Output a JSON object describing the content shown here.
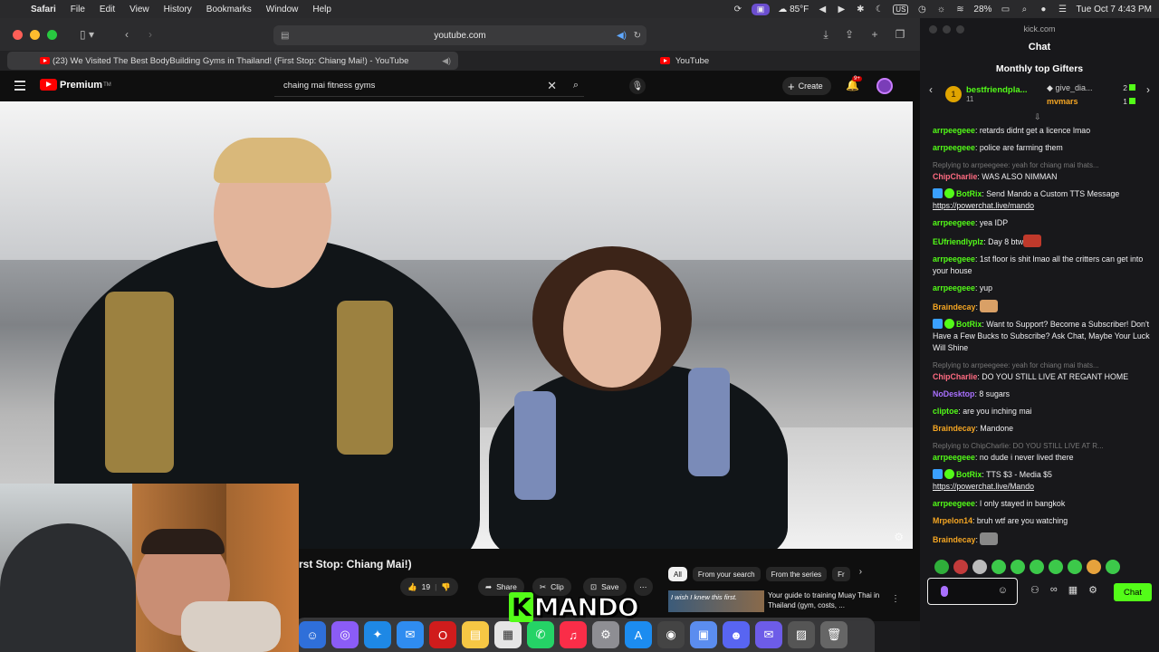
{
  "menubar": {
    "app": "Safari",
    "items": [
      "File",
      "Edit",
      "View",
      "History",
      "Bookmarks",
      "Window",
      "Help"
    ],
    "weather": "85°F",
    "input_source": "US",
    "battery": "28%",
    "datetime": "Tue Oct 7  4:43 PM"
  },
  "safari": {
    "address": "youtube.com",
    "tabs": [
      {
        "label": "(23) We Visited The Best BodyBuilding Gyms in Thailand! (First Stop: Chiang Mai!) - YouTube",
        "active": true
      },
      {
        "label": "YouTube",
        "active": false
      }
    ]
  },
  "youtube": {
    "logo_text": "Premium",
    "logo_tm": "TM",
    "search_value": "chaing mai fitness gyms",
    "create_label": "Create",
    "notif_count": "9+",
    "video_title": "rst Stop: Chiang Mai!)",
    "likes": "19",
    "actions": {
      "share": "Share",
      "clip": "Clip",
      "save": "Save"
    },
    "chips": [
      "All",
      "From your search",
      "From the series",
      "Fr"
    ],
    "rec_thumb_text": "I wish I knew this first.",
    "rec_title": "Your guide to training Muay Thai in Thailand (gym, costs, ..."
  },
  "overlay": {
    "mando_k": "K",
    "mando_text": "MANDO"
  },
  "kick": {
    "site": "kick.com",
    "chat_title": "Chat",
    "gifters_title": "Monthly top Gifters",
    "gifters": [
      {
        "name": "bestfriendpla...",
        "count": "11",
        "rank": "1"
      },
      {
        "name": "give_dia...",
        "count": "2"
      },
      {
        "name": "mvmars",
        "count": "1"
      }
    ],
    "messages": [
      {
        "user": "arrpeegeee",
        "color": "#53fc18",
        "text": "retards didnt get a licence lmao"
      },
      {
        "user": "arrpeegeee",
        "color": "#53fc18",
        "text": "police are farming them"
      },
      {
        "reply": "Replying to arrpeegeee: yeah for chiang mai thats...",
        "user": "ChipCharlie",
        "color": "#ff6b81",
        "text": "WAS ALSO NIMMAN"
      },
      {
        "user": "BotRix",
        "color": "#53fc18",
        "bot": true,
        "text": "Send Mando a Custom TTS Message ",
        "link": "https://powerchat.live/mando"
      },
      {
        "user": "arrpeegeee",
        "color": "#53fc18",
        "text": "yea IDP"
      },
      {
        "user": "EUfriendlyplz",
        "color": "#53fc18",
        "text": "Day 8 btw",
        "emote": "#c0392b"
      },
      {
        "user": "arrpeegeee",
        "color": "#53fc18",
        "text": "1st floor is shit lmao all the critters can get into your house"
      },
      {
        "user": "arrpeegeee",
        "color": "#53fc18",
        "text": "yup"
      },
      {
        "user": "Braindecay",
        "color": "#f5a623",
        "text": "",
        "emote": "#d9a066"
      },
      {
        "user": "BotRix",
        "color": "#53fc18",
        "bot": true,
        "text": "Want to Support? Become a Subscriber! Don't Have a Few Bucks to Subscribe? Ask Chat, Maybe Your Luck Will Shine"
      },
      {
        "reply": "Replying to arrpeegeee: yeah for chiang mai thats...",
        "user": "ChipCharlie",
        "color": "#ff6b81",
        "text": "DO YOU STILL LIVE AT REGANT HOME"
      },
      {
        "user": "NoDesktop",
        "color": "#a970ff",
        "text": "8 sugars"
      },
      {
        "user": "cliptoe",
        "color": "#53fc18",
        "text": "are you inching mai"
      },
      {
        "user": "Braindecay",
        "color": "#f5a623",
        "text": "Mandone"
      },
      {
        "reply": "Replying to ChipCharlie: DO YOU STILL LIVE AT R...",
        "user": "arrpeegeee",
        "color": "#53fc18",
        "text": "no dude i never lived there"
      },
      {
        "user": "BotRix",
        "color": "#53fc18",
        "bot": true,
        "text": "TTS $3 - Media $5 ",
        "link": "https://powerchat.live/Mando"
      },
      {
        "user": "arrpeegeee",
        "color": "#53fc18",
        "text": "I only stayed in bangkok"
      },
      {
        "user": "Mrpelon14",
        "color": "#f5a623",
        "text": "bruh wtf are you watching"
      },
      {
        "user": "Braindecay",
        "color": "#f5a623",
        "text": "",
        "emote": "#888888"
      }
    ],
    "chat_button": "Chat"
  },
  "colors": {
    "kick_green": "#53fc18",
    "yt_red": "#ff0000",
    "chat_bg": "#18181b"
  }
}
